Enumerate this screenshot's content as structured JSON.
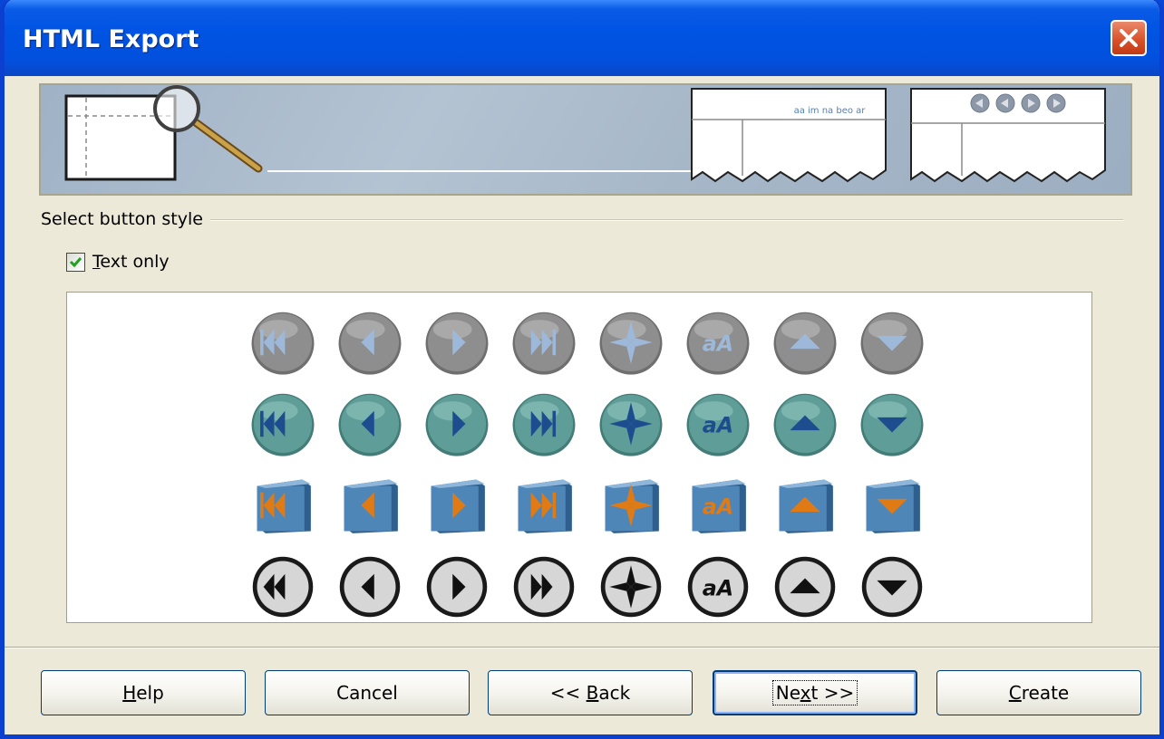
{
  "window": {
    "title": "HTML Export",
    "close_icon": "close-icon"
  },
  "banner": {
    "preview_nav_text": "aa im na beo ar",
    "icon": "magnifier-page-icon"
  },
  "section": {
    "label": "Select button style"
  },
  "text_only": {
    "label_underlined": "T",
    "label_rest": "ext only",
    "checked": true
  },
  "button_styles": [
    {
      "row": "gray-round",
      "icons": [
        "first-icon",
        "previous-icon",
        "next-icon",
        "last-icon",
        "navigator-icon",
        "text-size-icon",
        "up-icon",
        "down-icon"
      ]
    },
    {
      "row": "teal-round",
      "icons": [
        "first-icon",
        "previous-icon",
        "next-icon",
        "last-icon",
        "navigator-icon",
        "text-size-icon",
        "up-icon",
        "down-icon"
      ]
    },
    {
      "row": "blue-cube",
      "icons": [
        "first-icon",
        "previous-icon",
        "next-icon",
        "last-icon",
        "navigator-icon",
        "text-size-icon",
        "up-icon",
        "down-icon"
      ]
    },
    {
      "row": "outline-round",
      "icons": [
        "first-icon",
        "previous-icon",
        "next-icon",
        "last-icon",
        "navigator-icon",
        "text-size-icon",
        "up-icon",
        "down-icon"
      ]
    }
  ],
  "buttons": {
    "help": {
      "u": "H",
      "rest": "elp"
    },
    "cancel": "Cancel",
    "back": {
      "pre": "<< ",
      "u": "B",
      "rest": "ack"
    },
    "next": {
      "pre": "Ne",
      "u": "x",
      "rest": "t >>"
    },
    "create": {
      "u": "C",
      "rest": "reate"
    }
  },
  "colors": {
    "title_bar": "#0054e3",
    "dialog_bg": "#ece9d8",
    "close_button": "#d9522b",
    "checkbox_check": "#21a121"
  }
}
